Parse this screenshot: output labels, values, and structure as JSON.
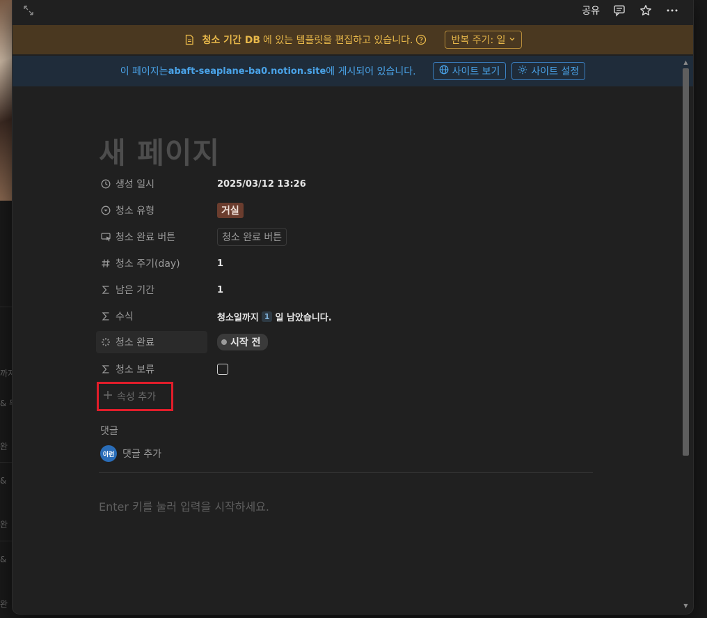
{
  "background": {
    "fragments": [
      "까지",
      "& 두",
      "완",
      "& ",
      "완",
      "& ",
      "완"
    ]
  },
  "topbar": {
    "share_label": "공유",
    "icons": [
      "expand-icon",
      "comment-icon",
      "star-icon",
      "more-icon"
    ]
  },
  "template_banner": {
    "db_name": "청소 기간 DB",
    "message": "에 있는 템플릿을 편집하고 있습니다.",
    "repeat_label": "반복 주기: 일"
  },
  "publish_banner": {
    "prefix": "이 페이지는 ",
    "url": "abaft-seaplane-ba0.notion.site",
    "suffix": "에 게시되어 있습니다.",
    "view_site_label": "사이트 보기",
    "site_settings_label": "사이트 설정"
  },
  "page": {
    "title": "새 페이지",
    "properties": [
      {
        "name": "생성 일시",
        "icon": "clock-icon",
        "value": "2025/03/12 13:26"
      },
      {
        "name": "청소 유형",
        "icon": "select-icon",
        "value": "거실"
      },
      {
        "name": "청소 완료 버튼",
        "icon": "button-icon",
        "value": "청소 완료 버튼"
      },
      {
        "name": "청소 주기(day)",
        "icon": "number-icon",
        "value": "1"
      },
      {
        "name": "남은 기간",
        "icon": "formula-icon",
        "value": "1"
      },
      {
        "name": "수식",
        "icon": "formula-icon",
        "value_prefix": "청소일까지",
        "value_num": "1",
        "value_suffix": "일 남았습니다."
      },
      {
        "name": "청소 완료",
        "icon": "status-icon",
        "value": "시작 전"
      },
      {
        "name": "청소 보류",
        "icon": "formula-icon",
        "value": ""
      }
    ],
    "add_property_label": "속성 추가",
    "comments_label": "댓글",
    "avatar_text": "이런",
    "add_comment_label": "댓글 추가",
    "editor_placeholder": "Enter 키를 눌러 입력을 시작하세요."
  },
  "colors": {
    "accent_warning": "#e8b84a",
    "accent_link": "#4aa3e8",
    "highlight_box": "#e11d2a"
  }
}
